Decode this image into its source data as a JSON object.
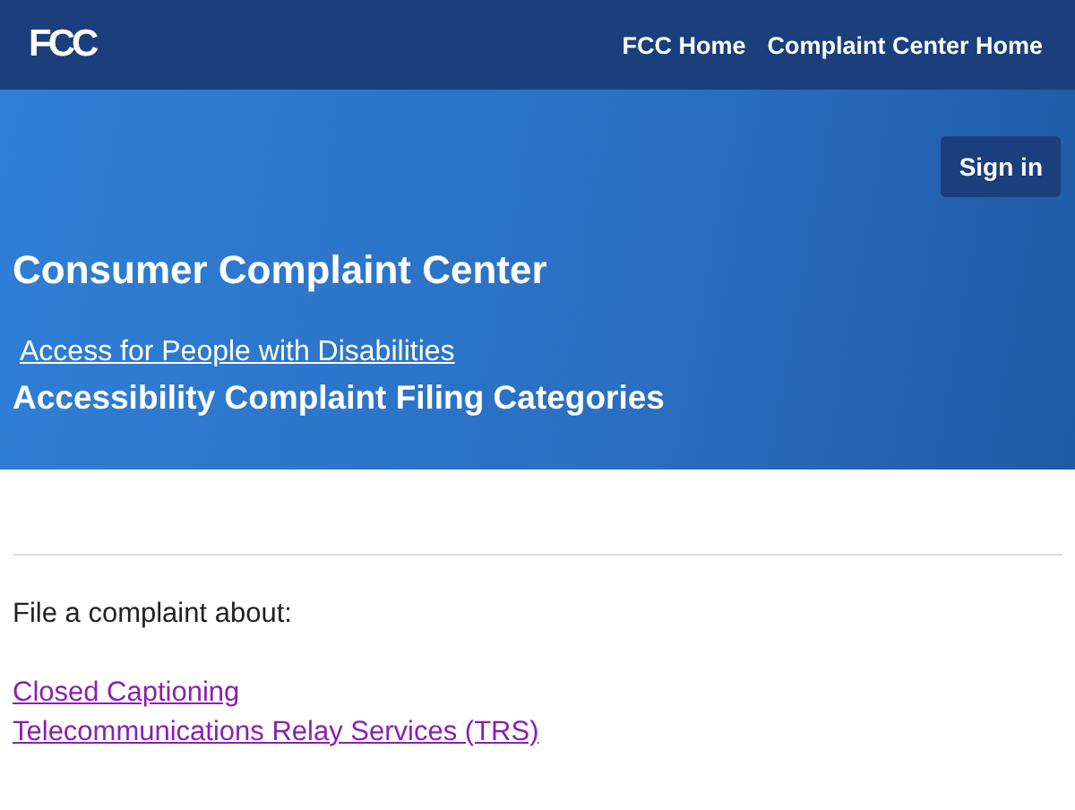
{
  "header": {
    "logo": "FCC",
    "nav": [
      {
        "label": "FCC Home"
      },
      {
        "label": "Complaint Center Home"
      }
    ]
  },
  "hero": {
    "sign_in": "Sign in",
    "title": "Consumer Complaint Center",
    "link": "Access for People with Disabilities",
    "subtitle": "Accessibility Complaint Filing Categories"
  },
  "content": {
    "intro": "File a complaint about:",
    "links": [
      {
        "label": "Closed Captioning",
        "visited": true
      },
      {
        "label": "Telecommunications Relay Services (TRS)",
        "visited": true
      }
    ]
  }
}
